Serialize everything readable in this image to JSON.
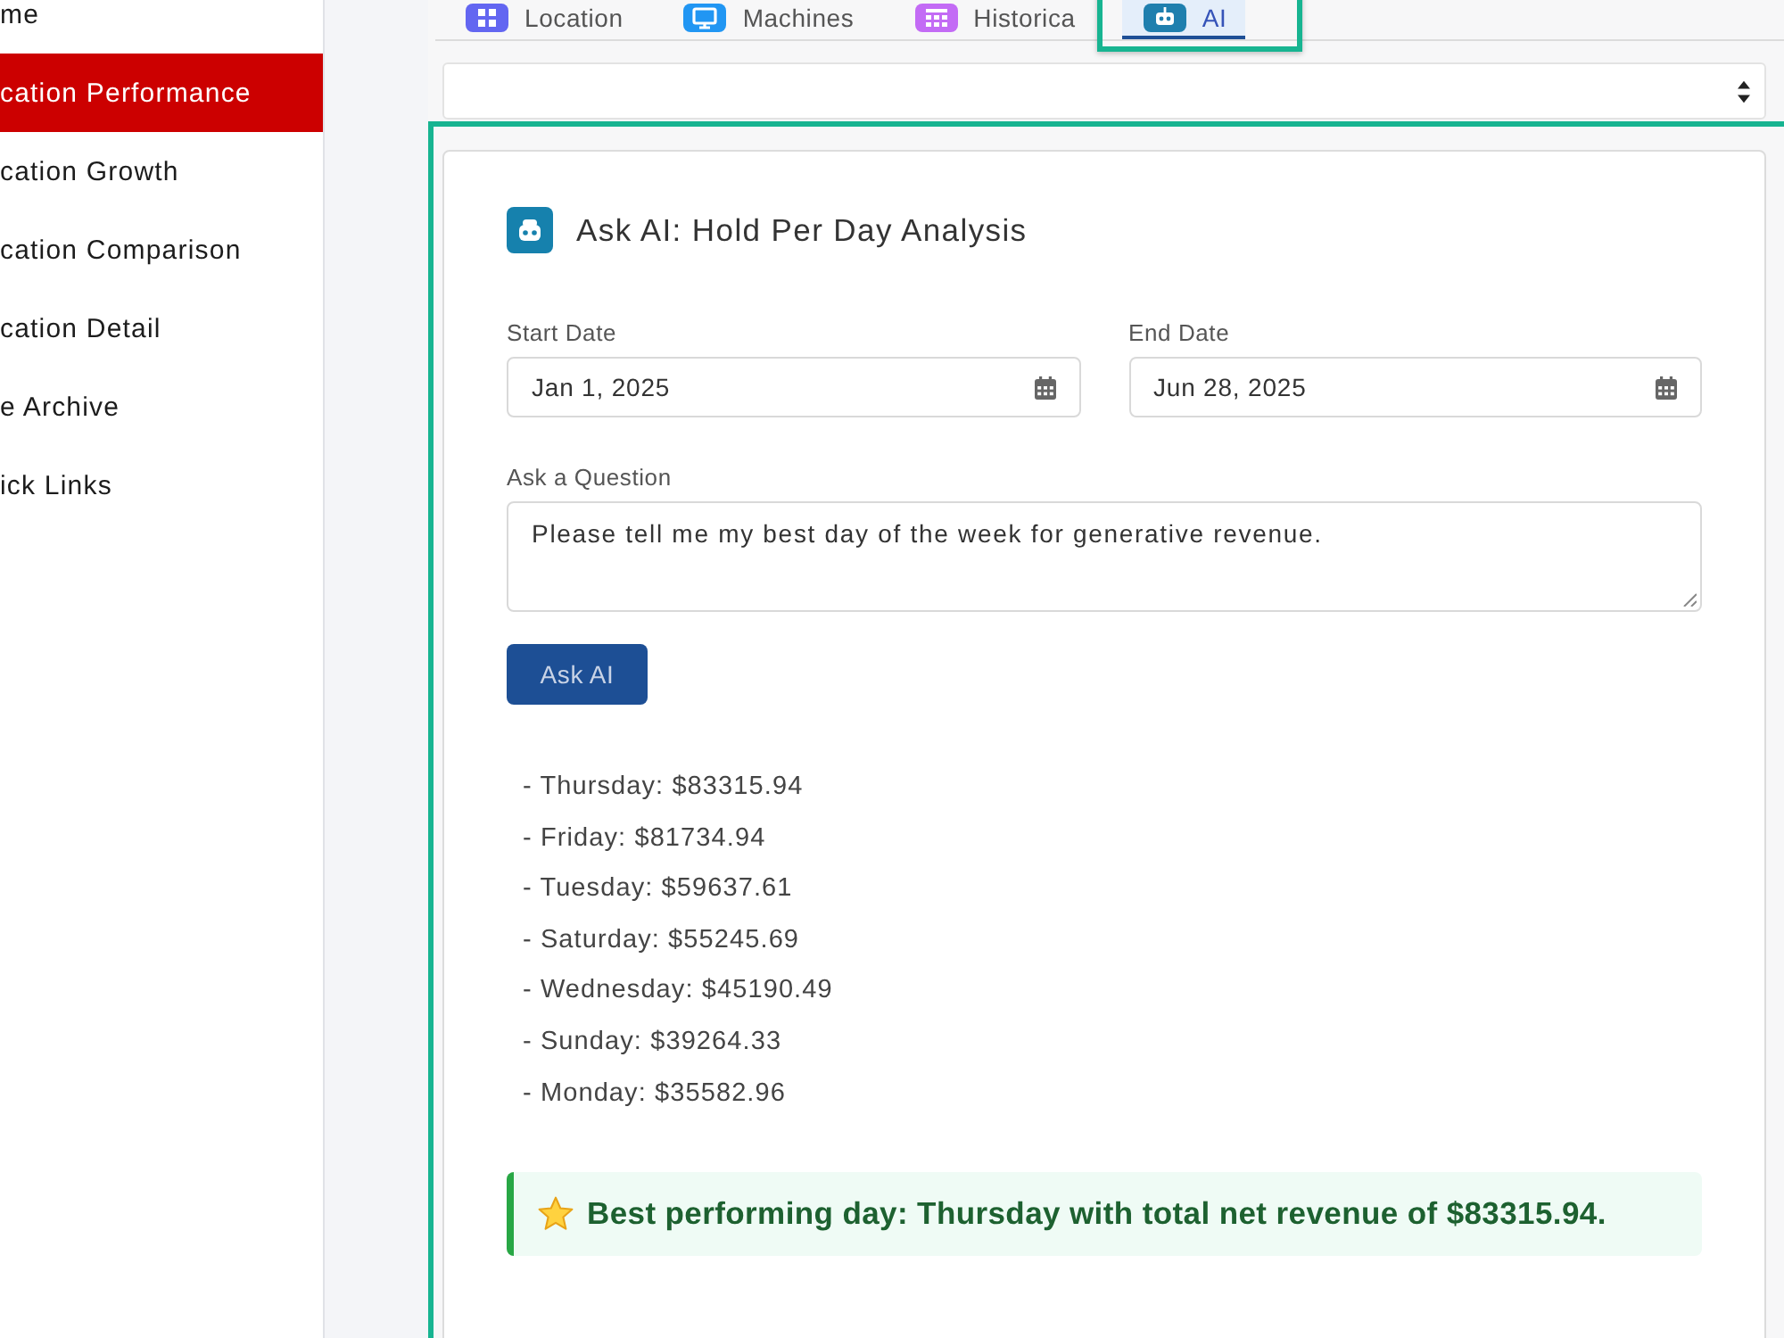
{
  "sidebar": {
    "items": [
      {
        "label": "me",
        "selected": false
      },
      {
        "label": "cation Performance",
        "selected": true
      },
      {
        "label": "cation Growth",
        "selected": false
      },
      {
        "label": "cation Comparison",
        "selected": false
      },
      {
        "label": "cation Detail",
        "selected": false
      },
      {
        "label": "e Archive",
        "selected": false
      },
      {
        "label": "ick Links",
        "selected": false
      }
    ]
  },
  "tabs": [
    {
      "label": "Location",
      "color": "#6366f1",
      "selected": false
    },
    {
      "label": "Machines",
      "color": "#2196f3",
      "selected": false
    },
    {
      "label": "Historica",
      "color": "#c36bf5",
      "selected": false
    },
    {
      "label": "AI",
      "color": "#1f7fae",
      "selected": true
    }
  ],
  "panel": {
    "title": "Ask AI: Hold Per Day Analysis",
    "start_date": {
      "label": "Start Date",
      "value": "Jan 1, 2025"
    },
    "end_date": {
      "label": "End Date",
      "value": "Jun 28, 2025"
    },
    "question": {
      "label": "Ask a Question",
      "value": "Please tell me my best day of the week for generative revenue."
    },
    "button": "Ask AI",
    "answer_lines": [
      "- Thursday: $83315.94",
      "- Friday: $81734.94",
      "- Tuesday: $59637.61",
      "- Saturday: $55245.69",
      "- Wednesday: $45190.49",
      "- Sunday: $39264.33",
      "- Monday: $35582.96"
    ],
    "summary": "Best performing day: Thursday with total net revenue of $83315.94."
  }
}
